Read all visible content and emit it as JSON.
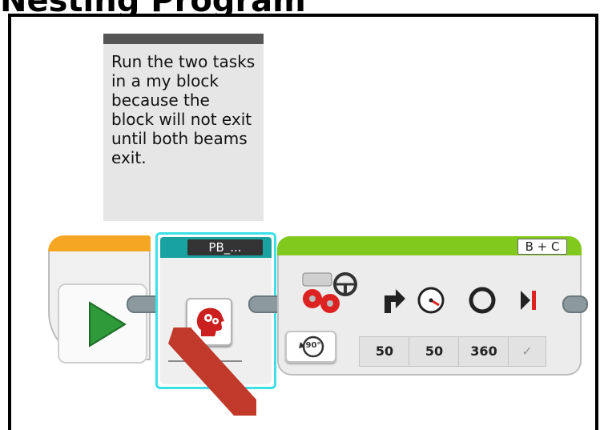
{
  "slide": {
    "title": "Nesting Program"
  },
  "comment": {
    "text": "Run the two tasks in a my block because the block will not exit until both beams exit."
  },
  "start_block": {
    "icon": "play-icon",
    "accent": "#f5a623"
  },
  "my_block": {
    "label": "PB_...",
    "icon": "gear-head-icon",
    "accent": "#19a3a0",
    "selection": "#3ee0e8"
  },
  "steering_block": {
    "port": "B + C",
    "mode_icon": "rotations-icon",
    "mode_value": "90°",
    "accent": "#82c91e",
    "params": [
      {
        "icon": "steering-arrow-icon",
        "value": "50"
      },
      {
        "icon": "speed-gauge-icon",
        "value": "50"
      },
      {
        "icon": "rotation-ring-icon",
        "value": "360"
      },
      {
        "icon": "brake-icon",
        "value": "✓"
      }
    ]
  },
  "annotation": {
    "color": "#c0392b"
  }
}
